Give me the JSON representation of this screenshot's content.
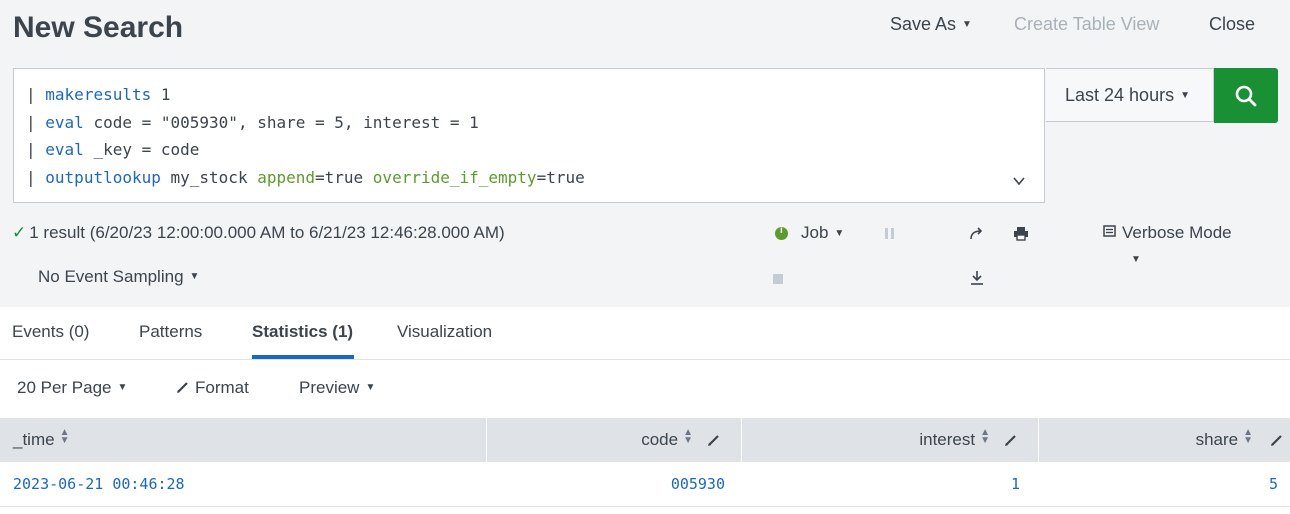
{
  "header": {
    "title": "New Search",
    "save_as": "Save As",
    "create_table_view": "Create Table View",
    "close": "Close"
  },
  "query": {
    "lines": [
      {
        "pipe": "|",
        "cmd": "makeresults",
        "rest": " 1"
      },
      {
        "pipe": "|",
        "cmd": "eval",
        "rest": " code = \"005930\", share = 5, interest = 1"
      },
      {
        "pipe": "|",
        "cmd": "eval",
        "rest": " _key = code"
      },
      {
        "pipe": "|",
        "cmd": "outputlookup",
        "rest1": " my_stock ",
        "arg1": "append",
        "val1": "=true ",
        "arg2": "override_if_empty",
        "val2": "=true"
      }
    ]
  },
  "time_range": "Last 24 hours",
  "status": {
    "check": "✓",
    "result_text": "1 result (6/20/23 12:00:00.000 AM to 6/21/23 12:46:28.000 AM)",
    "sampling": "No Event Sampling",
    "job": "Job",
    "mode": "Verbose Mode"
  },
  "tabs": [
    {
      "label": "Events (0)"
    },
    {
      "label": "Patterns"
    },
    {
      "label": "Statistics (1)",
      "active": true
    },
    {
      "label": "Visualization"
    }
  ],
  "options": {
    "per_page": "20 Per Page",
    "format": "Format",
    "preview": "Preview"
  },
  "table": {
    "columns": [
      "_time",
      "code",
      "interest",
      "share"
    ],
    "rows": [
      [
        "2023-06-21 00:46:28",
        "005930",
        "1",
        "5"
      ]
    ]
  },
  "colors": {
    "accent": "#1a67c7",
    "search_button": "#1a9035",
    "header_bg": "#f2f4f5"
  }
}
